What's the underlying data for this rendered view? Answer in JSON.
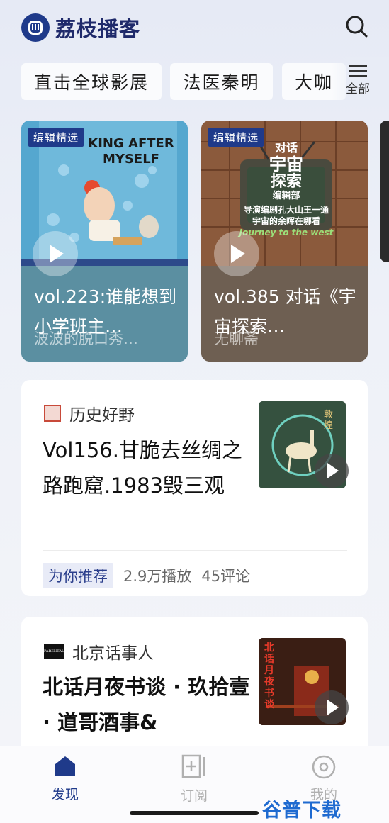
{
  "app": {
    "name": "荔枝播客"
  },
  "chips": [
    "直击全球影展",
    "法医秦明",
    "大咖"
  ],
  "all_label": "全部",
  "cards": [
    {
      "tag": "编辑精选",
      "cover_text_1": "KING AFTER",
      "cover_text_2": "MYSELF",
      "title": "vol.223:谁能想到小学班主…",
      "subtitle": "波波的脱口秀…"
    },
    {
      "tag": "编辑精选",
      "cover_text_1": "对话",
      "cover_text_2": "宇宙",
      "cover_text_3": "探索",
      "cover_text_4": "编辑部",
      "cover_text_5": "导演编剧孔大山王一通",
      "cover_text_6": "宇宙的余晖在哪看",
      "cover_text_7": "Journey to the west",
      "title": "vol.385 对话《宇宙探索…",
      "subtitle": "无聊斋"
    }
  ],
  "items": [
    {
      "source": "历史好野",
      "title": "Vol156.甘脆去丝绸之路跑窟.1983毁三观",
      "badge": "为你推荐",
      "plays": "2.9万播放",
      "comments": "45评论",
      "thumb_text": "敦煌"
    },
    {
      "source": "北京话事人",
      "source_icon_text": "PARENTAL",
      "title": "北话月夜书谈 · 玖拾壹 · 道哥酒事&",
      "thumb_text": "北话月夜书谈"
    }
  ],
  "nav": [
    {
      "label": "发现",
      "active": true
    },
    {
      "label": "订阅",
      "active": false
    },
    {
      "label": "我的",
      "active": false
    }
  ],
  "watermark": "谷普下载",
  "colors": {
    "brand": "#1f3a8a",
    "active_nav": "#1f3a8a",
    "inactive_nav": "#b0b0b0"
  }
}
